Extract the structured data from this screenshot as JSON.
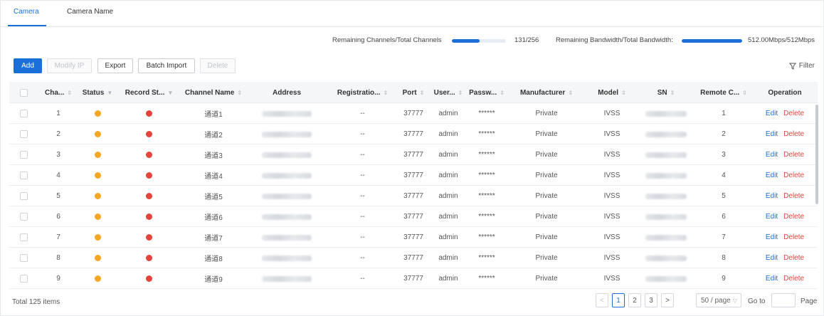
{
  "tabs": [
    {
      "label": "Camera",
      "active": true
    },
    {
      "label": "Camera Name",
      "active": false
    }
  ],
  "stats": {
    "channels_label": "Remaining Channels/Total Channels",
    "channels_value": "131/256",
    "channels_fraction": 0.51,
    "bandwidth_label": "Remaining Bandwidth/Total Bandwidth:",
    "bandwidth_value": "512.00Mbps/512Mbps",
    "bandwidth_fraction": 1.0
  },
  "toolbar": {
    "add": "Add",
    "modify_ip": "Modify IP",
    "export": "Export",
    "batch_import": "Batch Import",
    "delete": "Delete",
    "filter": "Filter"
  },
  "columns": [
    {
      "label": "Cha...",
      "sort": "⇕"
    },
    {
      "label": "Status",
      "sort": "▼"
    },
    {
      "label": "Record St...",
      "sort": "▼"
    },
    {
      "label": "Channel Name",
      "sort": "⇕"
    },
    {
      "label": "Address",
      "sort": ""
    },
    {
      "label": "Registratio...",
      "sort": "⇕"
    },
    {
      "label": "Port",
      "sort": "⇕"
    },
    {
      "label": "User...",
      "sort": "⇕"
    },
    {
      "label": "Passw...",
      "sort": "⇕"
    },
    {
      "label": "Manufacturer",
      "sort": "⇕"
    },
    {
      "label": "Model",
      "sort": "⇕"
    },
    {
      "label": "SN",
      "sort": "⇕"
    },
    {
      "label": "Remote C...",
      "sort": "⇕"
    },
    {
      "label": "Operation",
      "sort": ""
    }
  ],
  "rows": [
    {
      "channel": "1",
      "name": "通道1",
      "registration": "--",
      "port": "37777",
      "user": "admin",
      "password": "******",
      "manufacturer": "Private",
      "model": "IVSS",
      "remote": "1"
    },
    {
      "channel": "2",
      "name": "通道2",
      "registration": "--",
      "port": "37777",
      "user": "admin",
      "password": "******",
      "manufacturer": "Private",
      "model": "IVSS",
      "remote": "2"
    },
    {
      "channel": "3",
      "name": "通道3",
      "registration": "--",
      "port": "37777",
      "user": "admin",
      "password": "******",
      "manufacturer": "Private",
      "model": "IVSS",
      "remote": "3"
    },
    {
      "channel": "4",
      "name": "通道4",
      "registration": "--",
      "port": "37777",
      "user": "admin",
      "password": "******",
      "manufacturer": "Private",
      "model": "IVSS",
      "remote": "4"
    },
    {
      "channel": "5",
      "name": "通道5",
      "registration": "--",
      "port": "37777",
      "user": "admin",
      "password": "******",
      "manufacturer": "Private",
      "model": "IVSS",
      "remote": "5"
    },
    {
      "channel": "6",
      "name": "通道6",
      "registration": "--",
      "port": "37777",
      "user": "admin",
      "password": "******",
      "manufacturer": "Private",
      "model": "IVSS",
      "remote": "6"
    },
    {
      "channel": "7",
      "name": "通道7",
      "registration": "--",
      "port": "37777",
      "user": "admin",
      "password": "******",
      "manufacturer": "Private",
      "model": "IVSS",
      "remote": "7"
    },
    {
      "channel": "8",
      "name": "通道8",
      "registration": "--",
      "port": "37777",
      "user": "admin",
      "password": "******",
      "manufacturer": "Private",
      "model": "IVSS",
      "remote": "8"
    },
    {
      "channel": "9",
      "name": "通道9",
      "registration": "--",
      "port": "37777",
      "user": "admin",
      "password": "******",
      "manufacturer": "Private",
      "model": "IVSS",
      "remote": "9"
    }
  ],
  "row_actions": {
    "edit": "Edit",
    "delete": "Delete"
  },
  "colors": {
    "accent": "#1a6fd8",
    "status_online": "#f5a623",
    "record_status": "#e6443b",
    "delete_link": "#e0443b"
  },
  "pagination": {
    "total": "Total 125 items",
    "prev": "<",
    "pages": [
      "1",
      "2",
      "3"
    ],
    "current": "1",
    "next": ">",
    "page_size": "50 / page",
    "goto_label": "Go to",
    "page_label": "Page"
  }
}
